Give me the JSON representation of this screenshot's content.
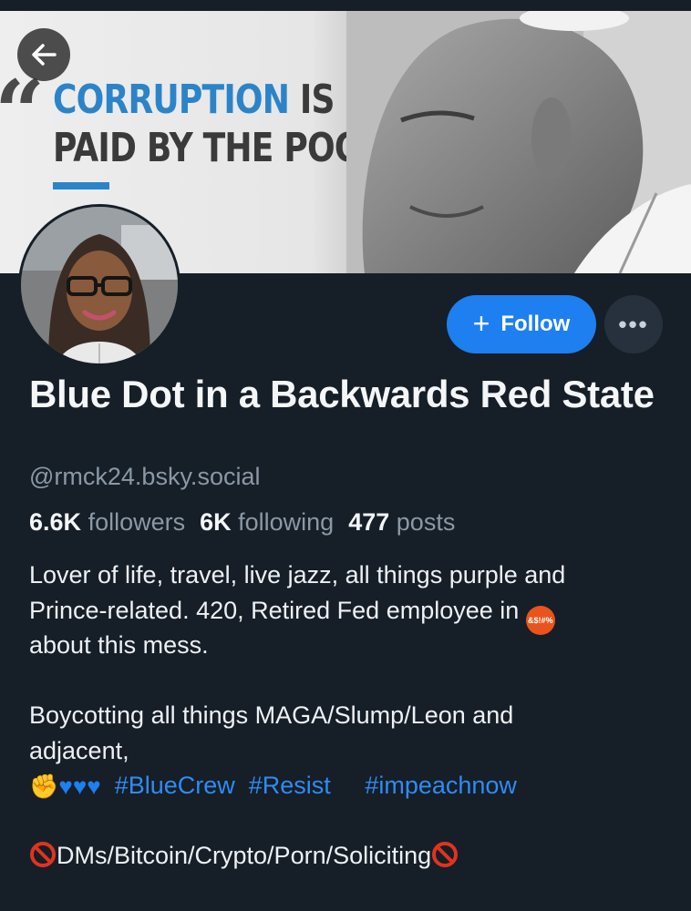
{
  "banner": {
    "quote_mark": "“",
    "quote_blue": "CORRUPTION",
    "quote_dark": " IS",
    "quote_line2": "PAID BY THE POOR."
  },
  "header": {
    "back_icon": "arrow-left-icon"
  },
  "profile": {
    "display_name": "Blue Dot in a Backwards Red State",
    "handle": "@rmck24.bsky.social",
    "follow_label": "Follow",
    "follow_icon": "plus-icon",
    "more_icon": "ellipsis-icon",
    "more_label": "•••",
    "stats": {
      "followers_value": "6.6K",
      "followers_label": "followers",
      "following_value": "6K",
      "following_label": "following",
      "posts_value": "477",
      "posts_label": "posts"
    },
    "bio": {
      "line1": "Lover of life, travel, live jazz, all things purple and",
      "line2": "Prince-related. 420, Retired Fed employee in",
      "rage_emoji_text": "&$!#%",
      "line3": "about this mess.",
      "line4": "Boycotting all things MAGA/Slump/Leon and",
      "line5": "adjacent,",
      "tag1": "#BlueCrew",
      "tag2": "#Resist",
      "tag3": "#impeachnow",
      "line6": "DMs/Bitcoin/Crypto/Porn/Soliciting"
    }
  },
  "colors": {
    "background": "#161e27",
    "accent": "#1d7ff0",
    "muted_text": "#8b98a6",
    "hashtag": "#2f8bf3"
  }
}
